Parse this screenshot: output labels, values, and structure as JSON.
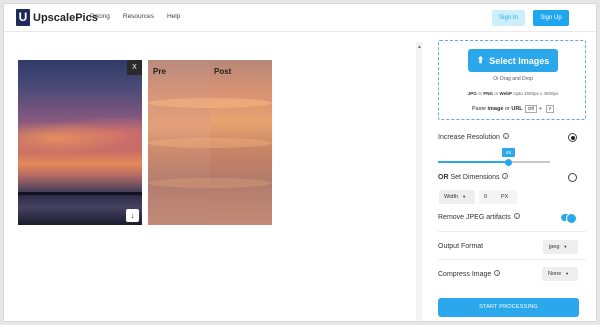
{
  "header": {
    "logo_letter": "U",
    "brand": "UpscalePics",
    "nav": [
      "Pricing",
      "Resources",
      "Help"
    ],
    "signin_label": "Sign In",
    "signup_label": "Sign Up"
  },
  "image_card": {
    "close_label": "X",
    "download_icon": "download-icon"
  },
  "compare": {
    "pre_label": "Pre",
    "post_label": "Post"
  },
  "upload": {
    "select_label": "Select Images",
    "drag_text": "Or Drag and Drop",
    "fmt_jpg": "JPG",
    "fmt_or1": " or ",
    "fmt_png": "PNG",
    "fmt_or2": " or ",
    "fmt_webp": "WebP",
    "fmt_limit": " Upto 4500px x 4500px",
    "paste_prefix": "Paste ",
    "paste_image": "image",
    "paste_or": " or ",
    "paste_url": "URL",
    "ctrl_key": "ctrl",
    "plus": "+",
    "v_key": "v"
  },
  "settings": {
    "increase_resolution_label": "Increase Resolution",
    "scale_value": "4X",
    "scale_level_fraction": 0.63,
    "or_label": "OR",
    "set_dimensions_label": " Set Dimensions",
    "dimension_select": "Width",
    "dimension_value": "0",
    "dimension_unit": "PX",
    "remove_artifacts_label": "Remove JPEG artifacts",
    "remove_artifacts_on": true,
    "output_format_label": "Output Format",
    "output_format_value": "jpeg",
    "compress_label": "Compress Image",
    "compress_value": "None",
    "start_label": "START PROCESSING"
  },
  "colors": {
    "accent": "#2ba8ec",
    "brand_dark": "#1e2a5a"
  }
}
